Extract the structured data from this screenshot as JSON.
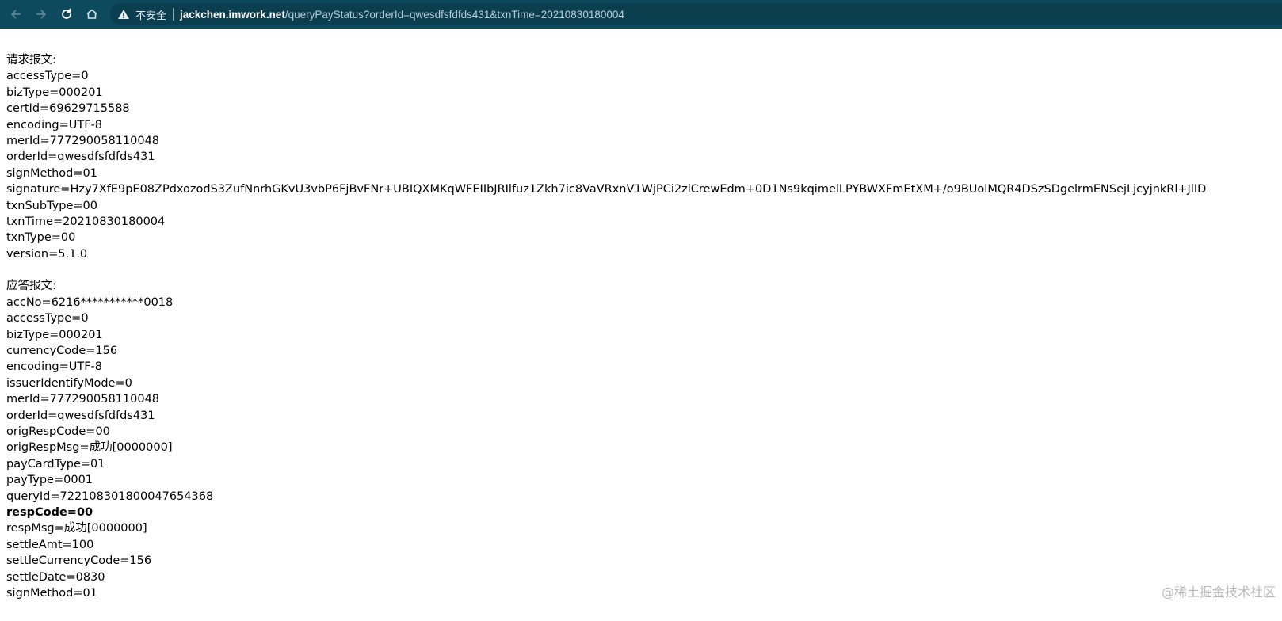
{
  "browser": {
    "security_label": "不安全",
    "url_host": "jackchen.imwork.net",
    "url_path": "/queryPayStatus?orderId=qwesdfsfdfds431&txnTime=20210830180004"
  },
  "request": {
    "heading": "请求报文:",
    "lines": [
      "accessType=0",
      "bizType=000201",
      "certId=69629715588",
      "encoding=UTF-8",
      "merId=777290058110048",
      "orderId=qwesdfsfdfds431",
      "signMethod=01",
      "signature=Hzy7XfE9pE08ZPdxozodS3ZufNnrhGKvU3vbP6FjBvFNr+UBIQXMKqWFEIIbJRIlfuz1Zkh7ic8VaVRxnV1WjPCi2zlCrewEdm+0D1Ns9kqimelLPYBWXFmEtXM+/o9BUolMQR4DSzSDgelrmENSejLjcyjnkRl+JlID",
      "txnSubType=00",
      "txnTime=20210830180004",
      "txnType=00",
      "version=5.1.0"
    ]
  },
  "response": {
    "heading": "应答报文:",
    "lines": [
      "accNo=6216***********0018",
      "accessType=0",
      "bizType=000201",
      "currencyCode=156",
      "encoding=UTF-8",
      "issuerIdentifyMode=0",
      "merId=777290058110048",
      "orderId=qwesdfsfdfds431",
      "origRespCode=00",
      "origRespMsg=成功[0000000]",
      "payCardType=01",
      "payType=0001",
      "queryId=722108301800047654368",
      "respCode=00",
      "respMsg=成功[0000000]",
      "settleAmt=100",
      "settleCurrencyCode=156",
      "settleDate=0830",
      "signMethod=01"
    ]
  },
  "watermark": "@稀土掘金技术社区"
}
